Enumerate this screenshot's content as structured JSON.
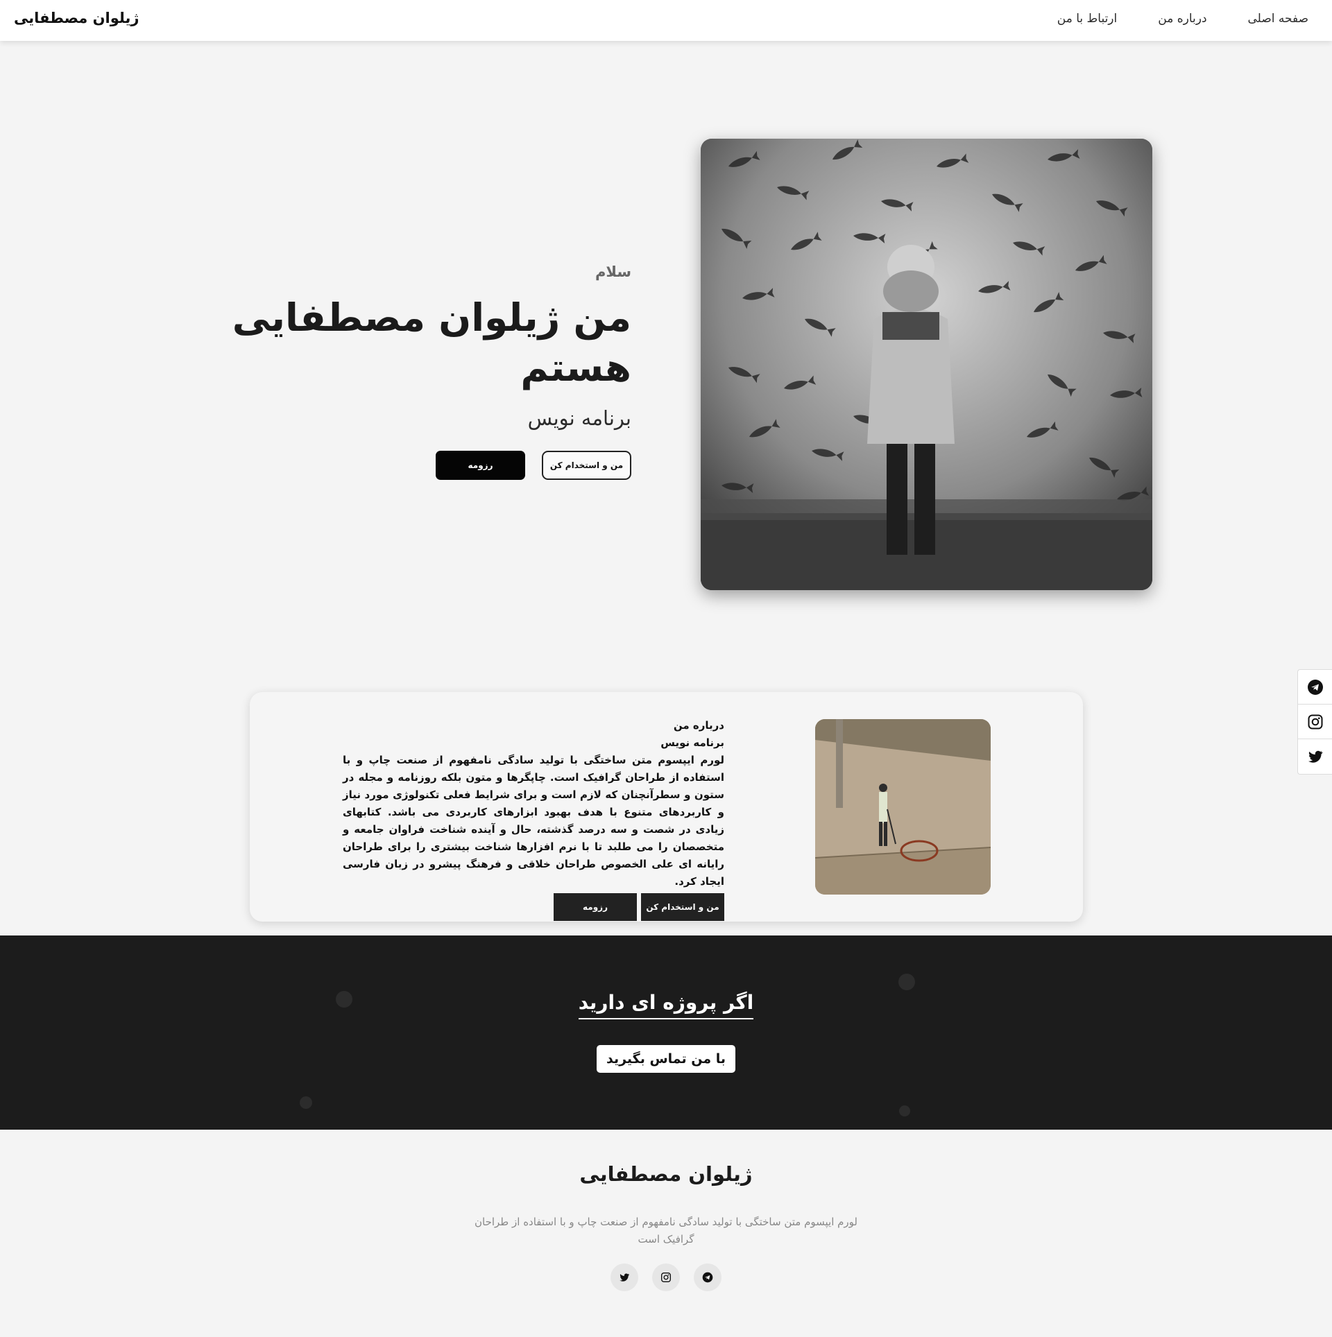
{
  "nav": {
    "brand": "ژیلوان مصطفایی",
    "links": [
      {
        "label": "صفحه اصلی"
      },
      {
        "label": "درباره من"
      },
      {
        "label": "ارتباط با من"
      }
    ]
  },
  "hero": {
    "greeting": "سلام",
    "title": "من ژیلوان مصطفایی هستم",
    "role": "برنامه نویس",
    "hire_button": "من و استخدام کن",
    "resume_button": "رزومه",
    "image_icon": "fish-wall-photo"
  },
  "social_sidebar": {
    "items": [
      {
        "icon": "telegram-icon"
      },
      {
        "icon": "instagram-icon"
      },
      {
        "icon": "twitter-icon"
      }
    ]
  },
  "about": {
    "heading": "درباره من",
    "subheading": "برنامه نویس",
    "body": "لورم ایپسوم متن ساختگی با تولید سادگی نامفهوم از صنعت چاپ و با استفاده از طراحان گرافیک است. چاپگرها و متون بلکه روزنامه و مجله در ستون و سطرآنچنان که لازم است و برای شرایط فعلی تکنولوژی مورد نیاز و کاربردهای متنوع با هدف بهبود ابزارهای کاربردی می باشد. کتابهای زیادی در شصت و سه درصد گذشته، حال و آینده شناخت فراوان جامعه و متخصصان را می طلبد تا با نرم افزارها شناخت بیشتری را برای طراحان رایانه ای علی الخصوص طراحان خلاقی و فرهنگ پیشرو در زبان فارسی ایجاد کرد.",
    "hire_button": "من و استخدام کن",
    "resume_button": "رزومه"
  },
  "cta": {
    "title": "اگر پروژه ای دارید",
    "button": "با من تماس بگیرید"
  },
  "footer": {
    "name": "ژیلوان مصطفایی",
    "description": "لورم ایپسوم متن ساختگی با تولید سادگی نامفهوم از صنعت چاپ و با استفاده از طراحان گرافیک است",
    "social": [
      {
        "icon": "telegram-icon"
      },
      {
        "icon": "instagram-icon"
      },
      {
        "icon": "twitter-icon"
      }
    ]
  },
  "colors": {
    "page_bg": "#f4f4f4",
    "navbar_bg": "#ffffff",
    "dark_band": "#1c1c1c",
    "button_dark": "#050505",
    "text_dark": "#1b1b1b"
  }
}
